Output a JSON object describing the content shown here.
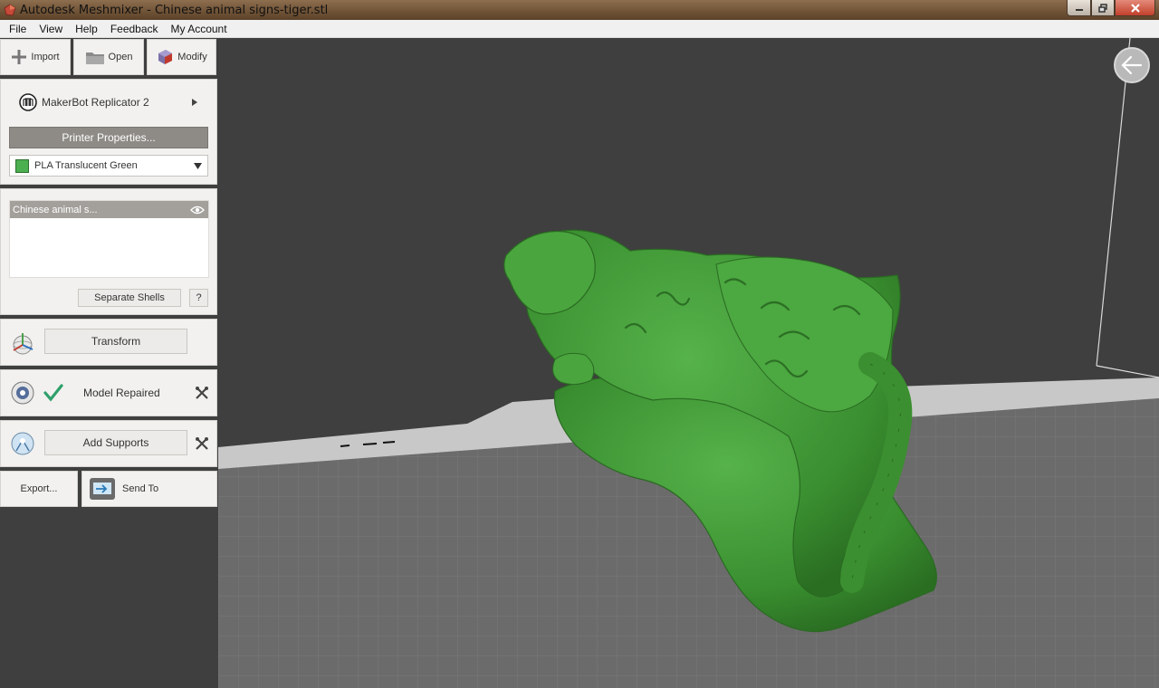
{
  "window": {
    "title": "Autodesk Meshmixer - Chinese animal signs-tiger.stl"
  },
  "menu": [
    "File",
    "View",
    "Help",
    "Feedback",
    "My Account"
  ],
  "toolbar": {
    "import_label": "Import",
    "open_label": "Open",
    "modify_label": "Modify"
  },
  "printer": {
    "name": "MakerBot Replicator 2",
    "properties_label": "Printer Properties...",
    "material": "PLA Translucent Green",
    "material_color": "#4caf50"
  },
  "objects": {
    "items": [
      "Chinese animal s..."
    ],
    "separate_shells_label": "Separate Shells",
    "help_label": "?"
  },
  "steps": {
    "transform_label": "Transform",
    "repair_label": "Model Repaired",
    "supports_label": "Add Supports"
  },
  "output": {
    "export_label": "Export...",
    "send_to_label": "Send To"
  },
  "colors": {
    "model_green": "#3e9a35",
    "check_green": "#2ea06a",
    "bed_gray": "#6b6b6b",
    "background": "#3f3f3f"
  },
  "icons": [
    "plus-icon",
    "folder-icon",
    "modify-icon",
    "makerbot-logo-icon",
    "eye-icon",
    "transform-sphere-icon",
    "check-icon",
    "wrench-icon",
    "support-sphere-icon",
    "send-to-icon",
    "back-arrow-icon"
  ]
}
